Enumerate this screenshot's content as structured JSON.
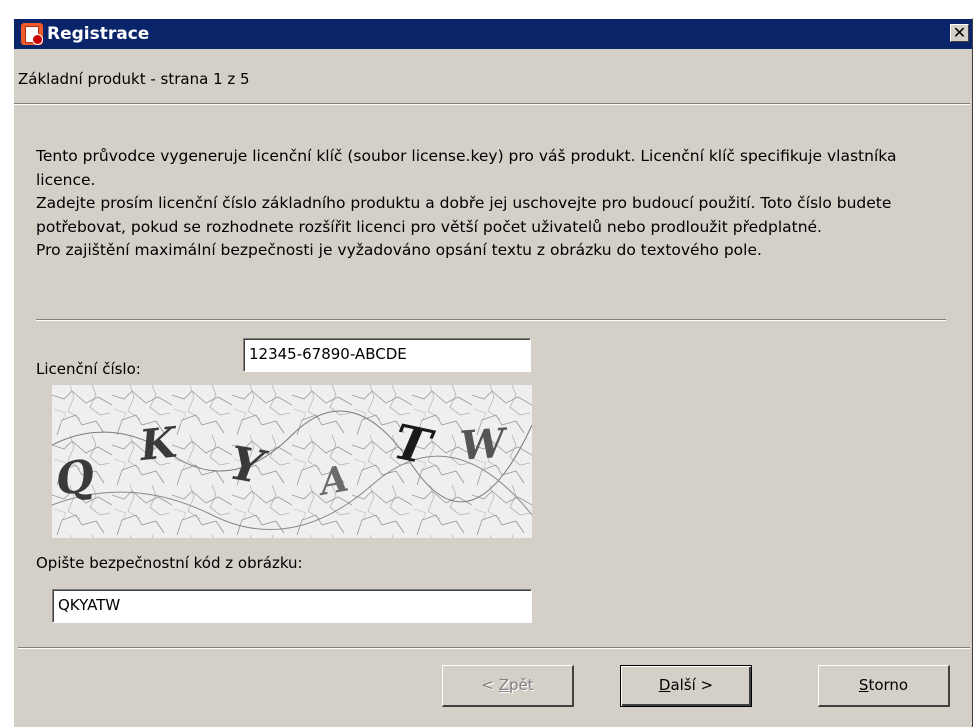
{
  "window": {
    "title": "Registrace",
    "close_glyph": "✕"
  },
  "page": {
    "header": "Základní produkt - strana 1 z 5"
  },
  "intro": {
    "line1": "Tento průvodce vygeneruje licenční klíč (soubor license.key) pro váš produkt. Licenční klíč specifikuje vlastníka licence.",
    "line2": "Zadejte prosím licenční číslo základního produktu a dobře jej uschovejte pro budoucí použití. Toto číslo budete potřebovat, pokud se rozhodnete rozšířit licenci pro větší počet uživatelů nebo prodloužit předplatné.",
    "line3": "Pro zajištění maximální bezpečnosti je vyžadováno opsání textu z obrázku do textového pole."
  },
  "license": {
    "label": "Licenční číslo:",
    "value": "12345-67890-ABCDE"
  },
  "captcha": {
    "letters": [
      "Q",
      "K",
      "Y",
      "A",
      "T",
      "W"
    ],
    "label": "Opište bezpečnostní kód z obrázku:",
    "value": "QKYATW"
  },
  "buttons": {
    "back": {
      "prefix": "< ",
      "mnemonic": "Z",
      "rest": "pět"
    },
    "next": {
      "mnemonic": "D",
      "rest": "alší >"
    },
    "cancel": {
      "mnemonic": "S",
      "rest": "torno"
    }
  },
  "colors": {
    "titlebar": "#0a246a",
    "dialog": "#d4d0c8"
  }
}
